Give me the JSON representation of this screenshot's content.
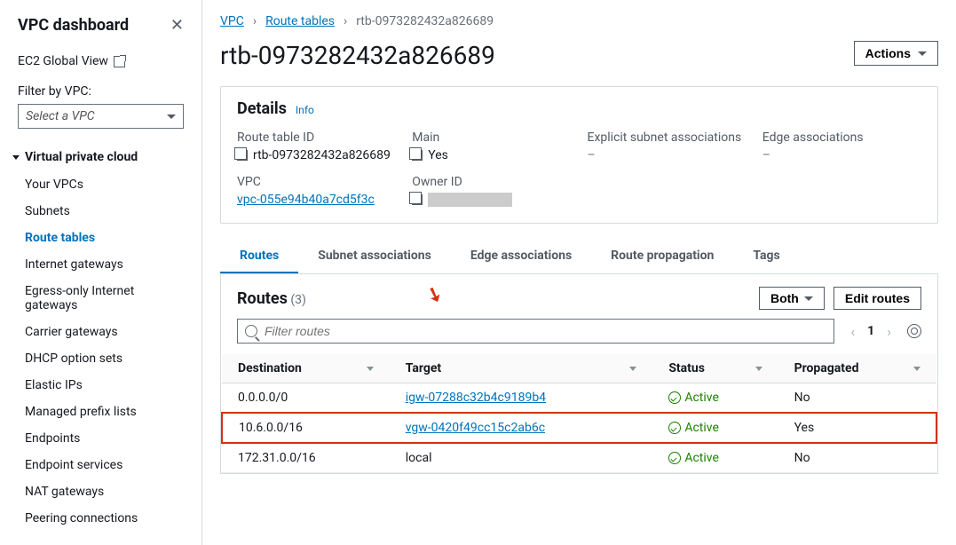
{
  "sidebar": {
    "title": "VPC dashboard",
    "ec2_link": "EC2 Global View",
    "filter_label": "Filter by VPC:",
    "select_placeholder": "Select a VPC",
    "section_title": "Virtual private cloud",
    "items": [
      {
        "label": "Your VPCs"
      },
      {
        "label": "Subnets"
      },
      {
        "label": "Route tables"
      },
      {
        "label": "Internet gateways"
      },
      {
        "label": "Egress-only Internet gateways"
      },
      {
        "label": "Carrier gateways"
      },
      {
        "label": "DHCP option sets"
      },
      {
        "label": "Elastic IPs"
      },
      {
        "label": "Managed prefix lists"
      },
      {
        "label": "Endpoints"
      },
      {
        "label": "Endpoint services"
      },
      {
        "label": "NAT gateways"
      },
      {
        "label": "Peering connections"
      }
    ]
  },
  "breadcrumbs": {
    "items": [
      "VPC",
      "Route tables",
      "rtb-0973282432a826689"
    ]
  },
  "page": {
    "title": "rtb-0973282432a826689",
    "actions_label": "Actions"
  },
  "details": {
    "title": "Details",
    "info": "Info",
    "route_table_id_label": "Route table ID",
    "route_table_id": "rtb-0973282432a826689",
    "vpc_label": "VPC",
    "vpc_id": "vpc-055e94b40a7cd5f3c",
    "main_label": "Main",
    "main_value": "Yes",
    "owner_label": "Owner ID",
    "explicit_label": "Explicit subnet associations",
    "explicit_value": "–",
    "edge_label": "Edge associations",
    "edge_value": "–"
  },
  "tabs": [
    "Routes",
    "Subnet associations",
    "Edge associations",
    "Route propagation",
    "Tags"
  ],
  "routes": {
    "title": "Routes",
    "count": "(3)",
    "both_label": "Both",
    "edit_label": "Edit routes",
    "filter_placeholder": "Filter routes",
    "page_num": "1",
    "columns": [
      "Destination",
      "Target",
      "Status",
      "Propagated"
    ],
    "rows": [
      {
        "dest": "0.0.0.0/0",
        "target": "igw-07288c32b4c9189b4",
        "target_link": true,
        "status": "Active",
        "prop": "No",
        "hl": false
      },
      {
        "dest": "10.6.0.0/16",
        "target": "vgw-0420f49cc15c2ab6c",
        "target_link": true,
        "status": "Active",
        "prop": "Yes",
        "hl": true
      },
      {
        "dest": "172.31.0.0/16",
        "target": "local",
        "target_link": false,
        "status": "Active",
        "prop": "No",
        "hl": false
      }
    ]
  }
}
